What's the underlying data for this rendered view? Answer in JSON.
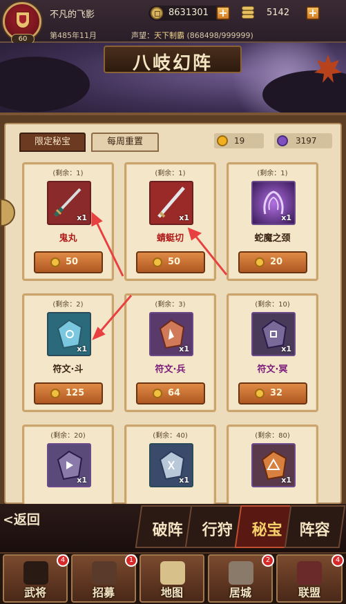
{
  "player": {
    "name": "不凡的飞影",
    "level": "60",
    "era": "第485年11月",
    "prestige_label": "声望：",
    "prestige_title": "天下制霸",
    "prestige_value": "(868498/999999)"
  },
  "currency": {
    "gold": "8631301",
    "ingot": "5142",
    "plus": "+"
  },
  "banner": {
    "title": "八岐幻阵"
  },
  "tabs": [
    {
      "label": "限定秘宝"
    },
    {
      "label": "每周重置"
    }
  ],
  "tokens": {
    "orange": "19",
    "purple": "3197"
  },
  "items": [
    {
      "remain": "(剩余：1)",
      "name": "鬼丸",
      "qty": "x1",
      "price": "50",
      "name_color": "#b01c1c"
    },
    {
      "remain": "(剩余：1)",
      "name": "蜻蜓切",
      "qty": "x1",
      "price": "50",
      "name_color": "#b01c1c"
    },
    {
      "remain": "(剩余：1)",
      "name": "蛇魔之颈",
      "qty": "x1",
      "price": "20",
      "name_color": "#3a2414"
    },
    {
      "remain": "(剩余：2)",
      "name": "符文·斗",
      "qty": "x1",
      "price": "125",
      "name_color": "#3a2414"
    },
    {
      "remain": "(剩余：3)",
      "name": "符文·兵",
      "qty": "x1",
      "price": "64",
      "name_color": "#7a1a7a"
    },
    {
      "remain": "(剩余：10)",
      "name": "符文·冥",
      "qty": "x1",
      "price": "32",
      "name_color": "#7a1a7a"
    },
    {
      "remain": "(剩余：20)",
      "name": "",
      "qty": "x1",
      "price": ""
    },
    {
      "remain": "(剩余：40)",
      "name": "",
      "qty": "x1",
      "price": ""
    },
    {
      "remain": "(剩余：80)",
      "name": "",
      "qty": "x1",
      "price": ""
    }
  ],
  "subnav": {
    "back": "<返回",
    "tabs": [
      "破阵",
      "行狩",
      "秘宝",
      "阵容"
    ],
    "active": "秘宝"
  },
  "mainnav": [
    {
      "label": "武将",
      "badge": "4"
    },
    {
      "label": "招募",
      "badge": "1"
    },
    {
      "label": "地图",
      "badge": ""
    },
    {
      "label": "居城",
      "badge": "2"
    },
    {
      "label": "联盟",
      "badge": "4"
    }
  ],
  "colors": {
    "accent": "#b05822",
    "panel": "#ecdcbc",
    "arrow": "#e03030"
  }
}
